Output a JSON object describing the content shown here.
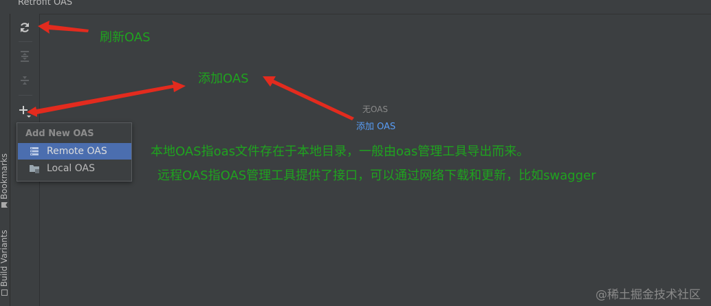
{
  "window": {
    "title": "Retrofit OAS"
  },
  "side_tabs": {
    "bookmarks": "Bookmarks",
    "build_variants": "Build Variants"
  },
  "toolbar": {
    "refresh_icon": "refresh-icon",
    "expand_icon": "expand-all-icon",
    "collapse_icon": "collapse-all-icon",
    "add_icon": "add-icon"
  },
  "empty_state": {
    "text": "无OAS",
    "link": "添加 OAS"
  },
  "add_popup": {
    "header": "Add New OAS",
    "items": [
      {
        "label": "Remote OAS",
        "icon": "remote-server-icon",
        "selected": true
      },
      {
        "label": "Local OAS",
        "icon": "local-folder-icon",
        "selected": false
      }
    ]
  },
  "annotations": {
    "refresh": "刷新OAS",
    "add": "添加OAS",
    "local_desc": "本地OAS指oas文件存在于本地目录，一般由oas管理工具导出而来。",
    "remote_desc": "远程OAS指OAS管理工具提供了接口，可以通过网络下载和更新，比如swagger"
  },
  "watermark": "@稀土掘金技术社区",
  "colors": {
    "annotation": "#1fa31f",
    "arrow": "#e32b1e",
    "selection": "#4b6eaf",
    "link": "#589df6"
  }
}
